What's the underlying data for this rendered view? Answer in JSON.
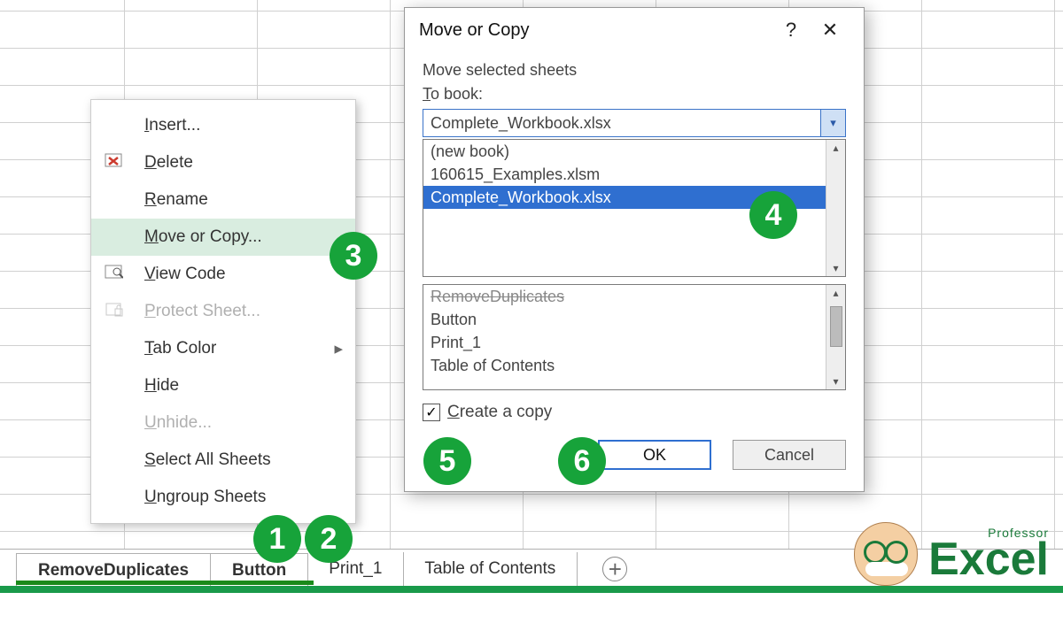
{
  "tabs": {
    "t0": "RemoveDuplicates",
    "t1": "Button",
    "t2": "Print_1",
    "t3": "Table of Contents"
  },
  "context_menu": {
    "insert": "Insert...",
    "delete": "Delete",
    "rename": "Rename",
    "move_copy": "Move or Copy...",
    "view_code": "View Code",
    "protect": "Protect Sheet...",
    "tab_color": "Tab Color",
    "hide": "Hide",
    "unhide": "Unhide...",
    "select_all": "Select All Sheets",
    "ungroup": "Ungroup Sheets"
  },
  "dialog": {
    "title": "Move or Copy",
    "subtitle": "Move selected sheets",
    "to_book_label": "To book:",
    "combo_value": "Complete_Workbook.xlsx",
    "book_options": {
      "b0": "(new book)",
      "b1": "160615_Examples.xlsm",
      "b2": "Complete_Workbook.xlsx"
    },
    "sheet_options": {
      "s0": "RemoveDuplicates",
      "s1": "Button",
      "s2": "Print_1",
      "s3": "Table of Contents"
    },
    "create_copy": "Create a copy",
    "ok": "OK",
    "cancel": "Cancel"
  },
  "callouts": {
    "c1": "1",
    "c2": "2",
    "c3": "3",
    "c4": "4",
    "c5": "5",
    "c6": "6"
  },
  "logo": {
    "small": "Professor",
    "big": "Excel"
  }
}
